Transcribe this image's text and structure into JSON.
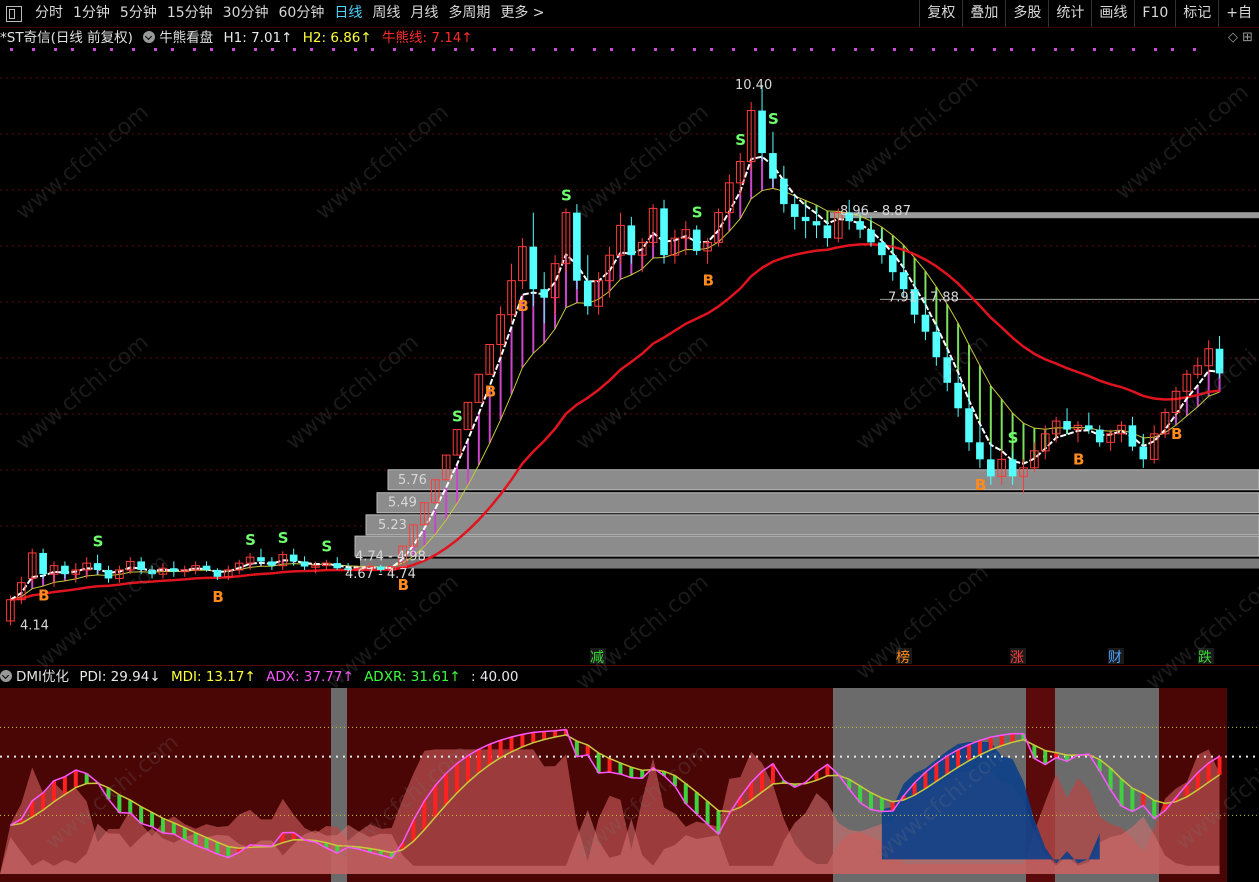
{
  "toolbar": {
    "tabs": [
      "分时",
      "1分钟",
      "5分钟",
      "15分钟",
      "30分钟",
      "60分钟",
      "日线",
      "周线",
      "月线",
      "多周期",
      "更多 >"
    ],
    "active_tab": "日线",
    "right_buttons": [
      "复权",
      "叠加",
      "多股",
      "统计",
      "画线",
      "F10",
      "标记",
      "+自"
    ]
  },
  "info": {
    "stock": "*ST奇信(日线 前复权)",
    "indicator": "牛熊看盘",
    "h1": "H1: 7.01↑",
    "h2": "H2: 6.86↑",
    "bull_bear_line": "牛熊线: 7.14↑",
    "right_icons": "◇ ⊞"
  },
  "sub_info": {
    "name": "DMI优化",
    "pdi": "PDI: 29.94↓",
    "mdi": "MDI: 13.17↑",
    "adx": "ADX: 37.77↑",
    "adxr": "ADXR: 31.61↑",
    "level": ": 40.00"
  },
  "watermark": "www.cfchi.com",
  "colors": {
    "up": "#ff3b3b",
    "down": "#54ffff",
    "bull_fill": "#cc44cc",
    "bear_fill": "#7de05a",
    "ma_red": "#e0141e",
    "gray_band": "#8c8c8c"
  },
  "chart_data": {
    "type": "candlestick",
    "price_range": [
      3.9,
      10.6
    ],
    "candles": [
      [
        4.1,
        4.4,
        4.05,
        4.35
      ],
      [
        4.35,
        4.62,
        4.3,
        4.55
      ],
      [
        4.6,
        4.95,
        4.55,
        4.9
      ],
      [
        4.9,
        4.95,
        4.6,
        4.65
      ],
      [
        4.65,
        4.8,
        4.5,
        4.75
      ],
      [
        4.75,
        4.8,
        4.6,
        4.65
      ],
      [
        4.65,
        4.78,
        4.55,
        4.7
      ],
      [
        4.7,
        4.85,
        4.6,
        4.78
      ],
      [
        4.78,
        4.88,
        4.65,
        4.7
      ],
      [
        4.7,
        4.75,
        4.55,
        4.6
      ],
      [
        4.6,
        4.75,
        4.55,
        4.7
      ],
      [
        4.7,
        4.85,
        4.65,
        4.8
      ],
      [
        4.8,
        4.85,
        4.65,
        4.7
      ],
      [
        4.7,
        4.75,
        4.6,
        4.65
      ],
      [
        4.65,
        4.78,
        4.6,
        4.72
      ],
      [
        4.72,
        4.8,
        4.62,
        4.68
      ],
      [
        4.68,
        4.75,
        4.62,
        4.7
      ],
      [
        4.7,
        4.8,
        4.65,
        4.75
      ],
      [
        4.75,
        4.8,
        4.68,
        4.7
      ],
      [
        4.7,
        4.72,
        4.58,
        4.62
      ],
      [
        4.62,
        4.75,
        4.58,
        4.7
      ],
      [
        4.7,
        4.82,
        4.65,
        4.78
      ],
      [
        4.78,
        4.9,
        4.7,
        4.85
      ],
      [
        4.85,
        4.95,
        4.75,
        4.8
      ],
      [
        4.8,
        4.85,
        4.7,
        4.75
      ],
      [
        4.75,
        4.92,
        4.7,
        4.88
      ],
      [
        4.88,
        4.95,
        4.75,
        4.8
      ],
      [
        4.8,
        4.86,
        4.7,
        4.74
      ],
      [
        4.74,
        4.8,
        4.66,
        4.75
      ],
      [
        4.75,
        4.82,
        4.7,
        4.78
      ],
      [
        4.78,
        4.85,
        4.7,
        4.72
      ],
      [
        4.72,
        4.78,
        4.66,
        4.7
      ],
      [
        4.7,
        4.74,
        4.67,
        4.72
      ],
      [
        4.72,
        4.78,
        4.68,
        4.74
      ],
      [
        4.74,
        4.76,
        4.67,
        4.7
      ],
      [
        4.7,
        4.74,
        4.66,
        4.74
      ],
      [
        4.74,
        4.98,
        4.72,
        4.98
      ],
      [
        4.98,
        5.23,
        4.98,
        5.23
      ],
      [
        5.23,
        5.49,
        5.23,
        5.49
      ],
      [
        5.49,
        5.76,
        5.49,
        5.76
      ],
      [
        5.76,
        6.05,
        5.76,
        6.05
      ],
      [
        6.05,
        6.35,
        6.05,
        6.35
      ],
      [
        6.35,
        6.67,
        6.35,
        6.67
      ],
      [
        6.67,
        7.0,
        6.67,
        7.0
      ],
      [
        7.0,
        7.35,
        7.0,
        7.35
      ],
      [
        7.35,
        7.8,
        7.2,
        7.7
      ],
      [
        7.7,
        8.3,
        7.6,
        8.1
      ],
      [
        8.1,
        8.6,
        8.0,
        8.5
      ],
      [
        8.5,
        8.9,
        7.8,
        8.0
      ],
      [
        8.0,
        8.2,
        7.6,
        7.9
      ],
      [
        7.9,
        8.4,
        7.7,
        8.3
      ],
      [
        8.3,
        8.95,
        8.2,
        8.9
      ],
      [
        8.9,
        9.0,
        8.0,
        8.1
      ],
      [
        8.1,
        8.4,
        7.7,
        7.8
      ],
      [
        7.8,
        8.2,
        7.7,
        8.1
      ],
      [
        8.1,
        8.5,
        7.9,
        8.4
      ],
      [
        8.4,
        8.9,
        8.3,
        8.75
      ],
      [
        8.75,
        8.85,
        8.3,
        8.4
      ],
      [
        8.4,
        8.6,
        8.2,
        8.55
      ],
      [
        8.55,
        9.0,
        8.5,
        8.95
      ],
      [
        8.95,
        9.05,
        8.3,
        8.4
      ],
      [
        8.4,
        8.7,
        8.3,
        8.6
      ],
      [
        8.6,
        8.8,
        8.4,
        8.7
      ],
      [
        8.7,
        8.75,
        8.4,
        8.45
      ],
      [
        8.45,
        8.6,
        8.3,
        8.55
      ],
      [
        8.55,
        8.95,
        8.5,
        8.9
      ],
      [
        8.9,
        9.35,
        8.8,
        9.25
      ],
      [
        9.25,
        9.6,
        9.1,
        9.5
      ],
      [
        9.5,
        10.2,
        9.4,
        10.1
      ],
      [
        10.1,
        10.4,
        9.5,
        9.6
      ],
      [
        9.6,
        9.85,
        9.2,
        9.3
      ],
      [
        9.3,
        9.45,
        8.9,
        9.0
      ],
      [
        9.0,
        9.1,
        8.7,
        8.85
      ],
      [
        8.85,
        9.0,
        8.6,
        8.8
      ],
      [
        8.8,
        8.95,
        8.6,
        8.75
      ],
      [
        8.75,
        8.8,
        8.5,
        8.6
      ],
      [
        8.6,
        8.95,
        8.55,
        8.9
      ],
      [
        8.9,
        9.05,
        8.7,
        8.8
      ],
      [
        8.8,
        8.9,
        8.6,
        8.7
      ],
      [
        8.7,
        8.85,
        8.5,
        8.55
      ],
      [
        8.55,
        8.7,
        8.3,
        8.4
      ],
      [
        8.4,
        8.5,
        8.1,
        8.2
      ],
      [
        8.2,
        8.4,
        7.9,
        8.0
      ],
      [
        8.0,
        8.1,
        7.6,
        7.7
      ],
      [
        7.7,
        7.9,
        7.4,
        7.5
      ],
      [
        7.5,
        7.6,
        7.1,
        7.2
      ],
      [
        7.2,
        7.3,
        6.8,
        6.9
      ],
      [
        6.9,
        7.0,
        6.5,
        6.6
      ],
      [
        6.6,
        6.8,
        6.1,
        6.2
      ],
      [
        6.2,
        6.4,
        5.9,
        6.0
      ],
      [
        6.0,
        6.2,
        5.7,
        5.8
      ],
      [
        5.8,
        6.1,
        5.7,
        6.0
      ],
      [
        6.0,
        6.1,
        5.7,
        5.8
      ],
      [
        5.8,
        6.0,
        5.6,
        5.9
      ],
      [
        5.9,
        6.2,
        5.85,
        6.1
      ],
      [
        6.1,
        6.4,
        6.0,
        6.3
      ],
      [
        6.3,
        6.5,
        6.2,
        6.45
      ],
      [
        6.45,
        6.6,
        6.3,
        6.35
      ],
      [
        6.35,
        6.45,
        6.2,
        6.4
      ],
      [
        6.4,
        6.55,
        6.3,
        6.35
      ],
      [
        6.35,
        6.4,
        6.15,
        6.2
      ],
      [
        6.2,
        6.35,
        6.1,
        6.3
      ],
      [
        6.3,
        6.45,
        6.2,
        6.4
      ],
      [
        6.4,
        6.5,
        6.1,
        6.15
      ],
      [
        6.15,
        6.3,
        5.9,
        6.0
      ],
      [
        6.0,
        6.4,
        5.95,
        6.3
      ],
      [
        6.3,
        6.6,
        6.25,
        6.55
      ],
      [
        6.55,
        6.85,
        6.5,
        6.8
      ],
      [
        6.8,
        7.05,
        6.75,
        7.0
      ],
      [
        7.0,
        7.2,
        6.95,
        7.1
      ],
      [
        7.1,
        7.4,
        7.0,
        7.3
      ],
      [
        7.3,
        7.45,
        6.95,
        7.01
      ]
    ],
    "price_labels": [
      "10.40",
      "8.96 - 8.87",
      "7.91 - 7.88",
      "5.76",
      "5.49",
      "5.23",
      "4.74 - 4.98",
      "4.67 - 4.74",
      "4.14"
    ],
    "signals": {
      "buy": "B",
      "sell": "S"
    },
    "bottom_tags": [
      "减",
      "榜",
      "涨",
      "财",
      "跌"
    ],
    "dmi": {
      "pdi": 29.94,
      "mdi": 13.17,
      "adx": 37.77,
      "adxr": 31.61,
      "level": 40.0
    }
  }
}
